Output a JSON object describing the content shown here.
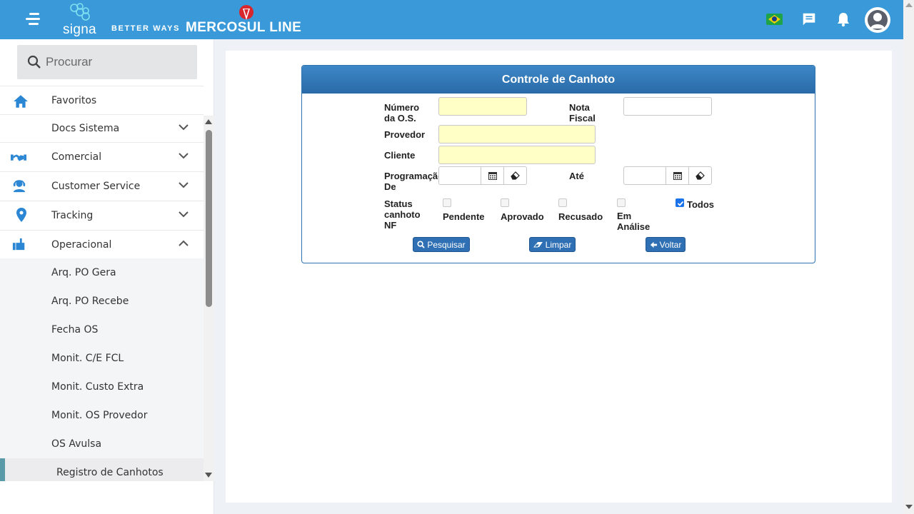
{
  "header": {
    "brand_signa": "signa",
    "brand_tagline": "BETTER WAYS",
    "brand_company": "MERCOSUL LINE"
  },
  "sidebar": {
    "search_placeholder": "Procurar",
    "items": [
      {
        "label": "Favoritos",
        "icon": "home-icon"
      },
      {
        "label": "Docs Sistema",
        "icon": ""
      },
      {
        "label": "Comercial",
        "icon": "handshake-icon"
      },
      {
        "label": "Customer Service",
        "icon": "support-agent-icon"
      },
      {
        "label": "Tracking",
        "icon": "location-pin-icon"
      },
      {
        "label": "Operacional",
        "icon": "operations-icon"
      }
    ],
    "sub_items": [
      {
        "label": "Arq. PO Gera"
      },
      {
        "label": "Arq. PO Recebe"
      },
      {
        "label": "Fecha OS"
      },
      {
        "label": "Monit. C/E FCL"
      },
      {
        "label": "Monit. Custo Extra"
      },
      {
        "label": "Monit. OS Provedor"
      },
      {
        "label": "OS Avulsa"
      },
      {
        "label": "Registro de Canhotos"
      }
    ]
  },
  "form": {
    "title": "Controle de Canhoto",
    "labels": {
      "numero_os_1": "Número",
      "numero_os_2": "da O.S.",
      "nota_fiscal_1": "Nota",
      "nota_fiscal_2": "Fiscal",
      "provedor": "Provedor",
      "cliente": "Cliente",
      "programacao_1": "Programação",
      "programacao_2": "De",
      "ate": "Até",
      "status_1": "Status",
      "status_2": "canhoto",
      "status_3": "NF"
    },
    "values": {
      "numero_os": "",
      "nota_fiscal": "",
      "provedor": "",
      "cliente": "",
      "programacao_de": "",
      "ate": ""
    },
    "status_options": [
      {
        "label": "Pendente",
        "checked": false
      },
      {
        "label": "Aprovado",
        "checked": false
      },
      {
        "label": "Recusado",
        "checked": false
      },
      {
        "label_1": "Em",
        "label_2": "Análise",
        "checked": false
      },
      {
        "label": "Todos",
        "checked": true
      }
    ],
    "buttons": {
      "pesquisar": "Pesquisar",
      "limpar": "Limpar",
      "voltar": "Voltar"
    }
  },
  "colors": {
    "topbar": "#3a9ad9",
    "panel_header": "#2f73b0",
    "required_field": "#ffffc6",
    "button": "#2f6fb3"
  }
}
